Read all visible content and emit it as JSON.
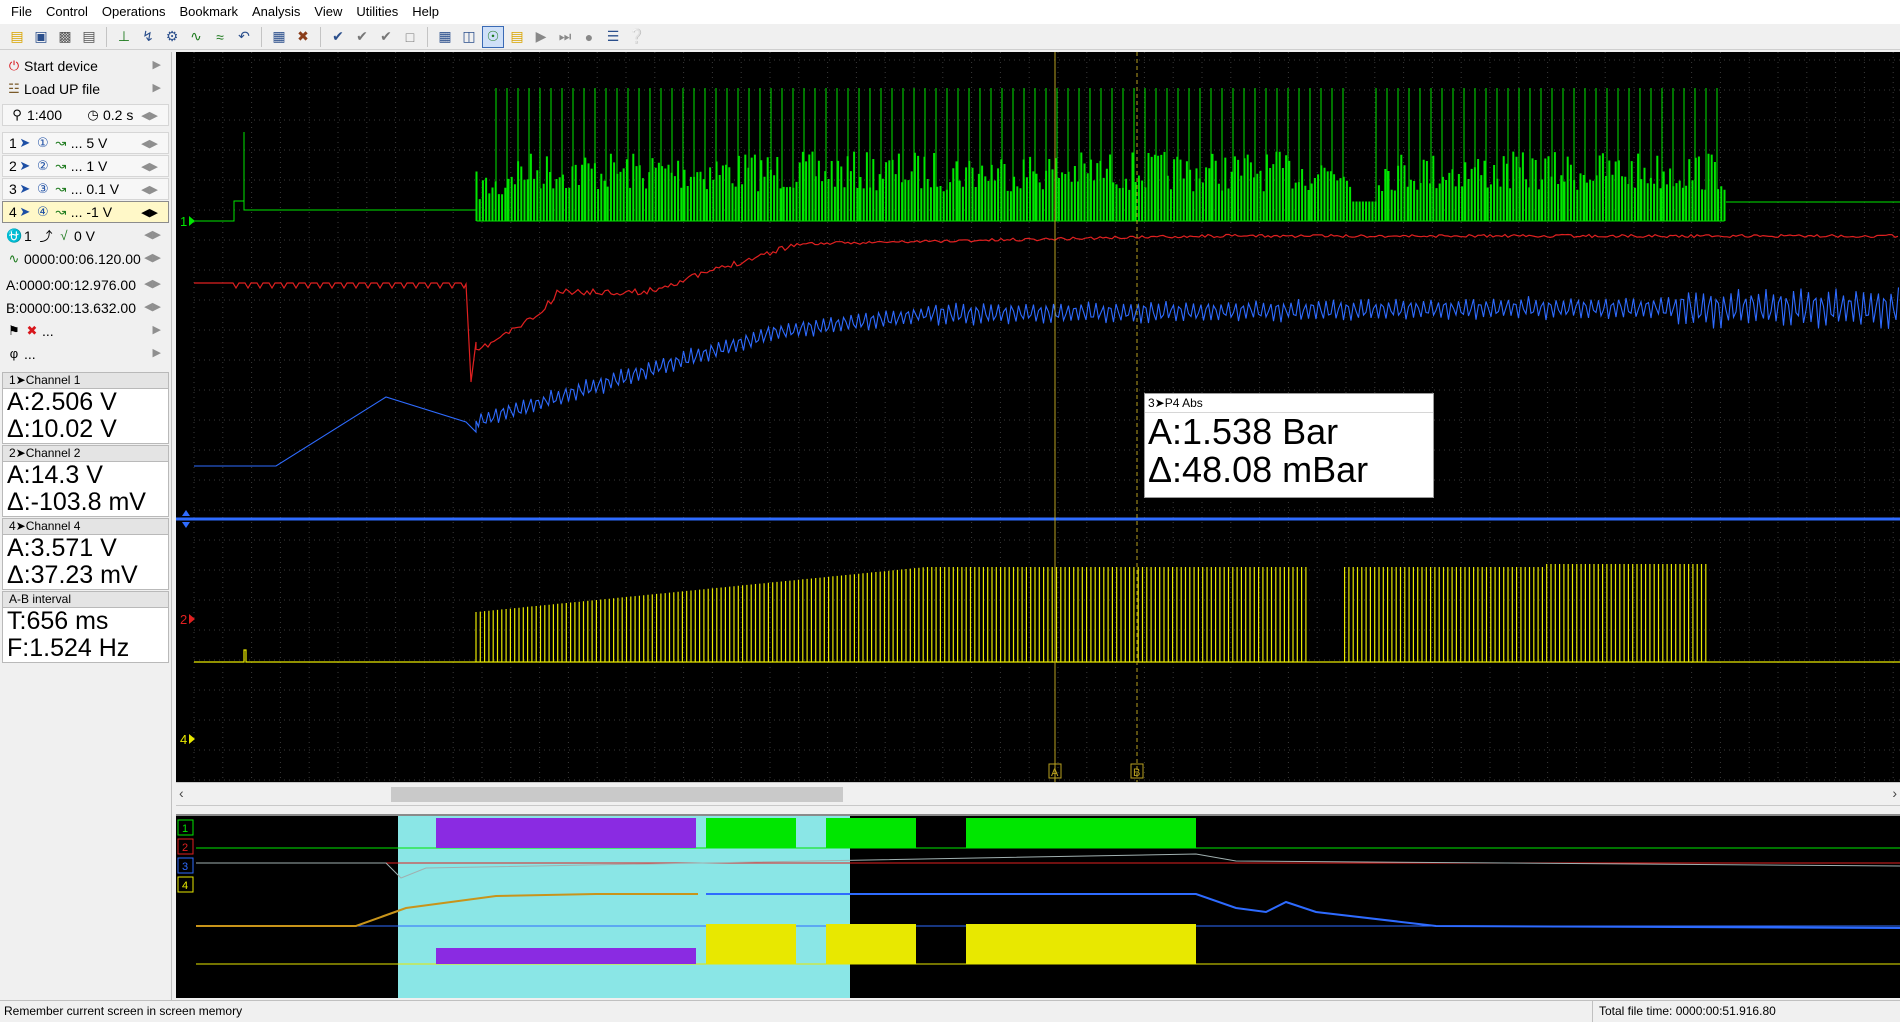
{
  "menu": [
    "File",
    "Control",
    "Operations",
    "Bookmark",
    "Analysis",
    "View",
    "Utilities",
    "Help"
  ],
  "toolbar": {
    "icons": [
      "open-folder-icon",
      "save-icon",
      "print-icon",
      "print-preview-icon",
      "cursor-icon",
      "probe-icon",
      "channel-settings-icon",
      "waveform-icon",
      "filter-icon",
      "undo-icon",
      "zoom-icon",
      "clear-icon",
      "check-icon",
      "check-double-icon",
      "check-all-icon",
      "page-icon",
      "fit-icon",
      "range-icon",
      "pair-icon",
      "export-icon",
      "play-icon",
      "step-icon",
      "record-icon",
      "list-icon",
      "help-icon"
    ]
  },
  "left_panel": {
    "start_device": "Start device",
    "load_up_file": "Load UP file",
    "scale": "1:400",
    "time_div": "0.2 s",
    "channels": [
      {
        "num": "1",
        "scale": "... 5 V"
      },
      {
        "num": "2",
        "scale": "... 1 V"
      },
      {
        "num": "3",
        "scale": "... 0.1 V"
      },
      {
        "num": "4",
        "scale": "... -1 V"
      }
    ],
    "trigger": "1",
    "trigger_level": "0 V",
    "position": "0000:00:06.120.00",
    "cursor_a": "A:0000:00:12.976.00",
    "cursor_b": "B:0000:00:13.632.00",
    "extra_1": "...",
    "extra_2": "..."
  },
  "measurements": [
    {
      "title": "Channel 1",
      "a": "A:2.506 V",
      "d": "Δ:10.02 V"
    },
    {
      "title": "Channel 2",
      "a": "A:14.3 V",
      "d": "Δ:-103.8 mV"
    },
    {
      "title": "Channel 4",
      "a": "A:3.571 V",
      "d": "Δ:37.23 mV"
    }
  ],
  "interval": {
    "title": "A-B interval",
    "t": "T:656 ms",
    "f": "F:1.524 Hz"
  },
  "overlay": {
    "title": "P4 Abs",
    "a": "A:1.538 Bar",
    "d": "Δ:48.08 mBar"
  },
  "scope": {
    "channel_markers": [
      "1",
      "2",
      "4"
    ],
    "cursor_labels": [
      "A",
      "B"
    ],
    "colors": {
      "ch1": "#00e600",
      "ch2": "#e02020",
      "ch3": "#2e6bff",
      "ch4": "#e8e800",
      "grid": "#3a3a3a",
      "cursor": "#b8a020"
    }
  },
  "overview": {
    "channel_labels": [
      "1",
      "2",
      "3",
      "4"
    ],
    "highlight_color": "#8ae6e6",
    "accent_color": "#8a2be2"
  },
  "status": {
    "left": "Remember current screen in screen memory",
    "right": "Total file time: 0000:00:51.916.80"
  }
}
